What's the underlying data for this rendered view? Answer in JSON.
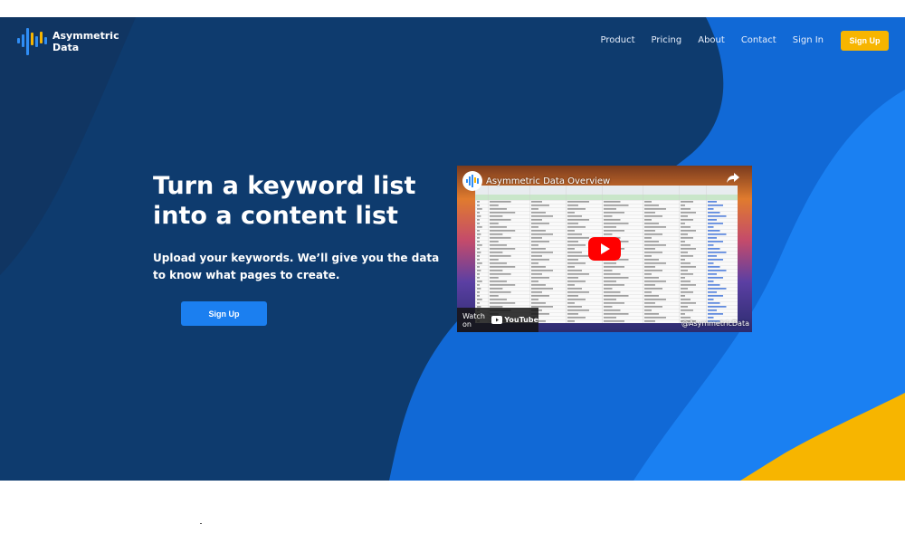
{
  "brand": {
    "name": "Asymmetric Data",
    "logo_icon": "soundwave-bars-icon"
  },
  "nav": {
    "links": [
      "Product",
      "Pricing",
      "About",
      "Contact",
      "Sign In"
    ],
    "signup_label": "Sign Up"
  },
  "hero": {
    "headline": "Turn a keyword list into a content list",
    "subhead": "Upload your keywords. We’ll give you the data to know what pages to create.",
    "cta_label": "Sign Up"
  },
  "video": {
    "title": "Asymmetric Data Overview",
    "watch_on": "Watch on",
    "platform": "YouTube",
    "handle": "@AsymmetricData",
    "icons": [
      "play-icon",
      "share-icon",
      "youtube-icon"
    ]
  },
  "colors": {
    "navy": "#0e3b6e",
    "blue": "#1b7ff0",
    "yellow": "#f7b500",
    "youtube_red": "#ff0000"
  }
}
